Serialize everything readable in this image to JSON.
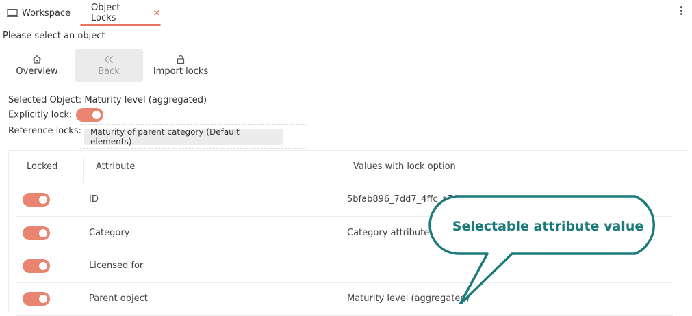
{
  "tabs": [
    {
      "label": "Workspace"
    },
    {
      "label": "Object Locks",
      "close": "×"
    }
  ],
  "hint": "Please select an object",
  "toolbar": {
    "overview": "Overview",
    "back": "Back",
    "import": "Import locks"
  },
  "selected_object": "Selected Object: Maturity level (aggregated)",
  "explicit_lock_label": "Explicitly lock:",
  "reference_locks_label": "Reference locks:",
  "reference_chip": "Maturity of parent category (Default elements)",
  "table": {
    "headers": [
      "Locked",
      "Attribute",
      "Values with lock option"
    ],
    "rows": [
      {
        "attribute": "ID",
        "value": "5bfab896_7dd7_4ffc_a76",
        "locked": true
      },
      {
        "attribute": "Category",
        "value": "Category attribute",
        "locked": true
      },
      {
        "attribute": "Licensed for",
        "value": "",
        "locked": true
      },
      {
        "attribute": "Parent object",
        "value": "Maturity level (aggregated)",
        "locked": true
      }
    ]
  },
  "callout": "Selectable attribute value",
  "colors": {
    "accent": "#e8735f",
    "toggle": "#e8846f",
    "callout": "#1b7a7a"
  }
}
